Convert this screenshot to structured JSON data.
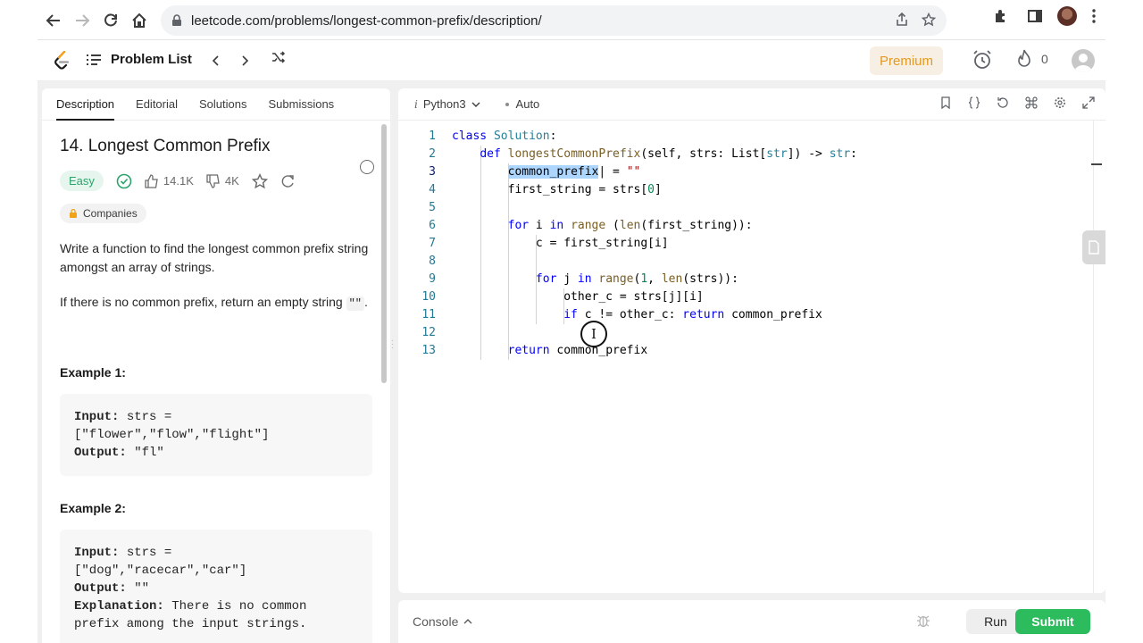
{
  "browser": {
    "url": "leetcode.com/problems/longest-common-prefix/description/"
  },
  "header": {
    "problem_list_label": "Problem List",
    "premium_label": "Premium",
    "streak_count": "0"
  },
  "left_tabs": [
    "Description",
    "Editorial",
    "Solutions",
    "Submissions"
  ],
  "problem": {
    "title": "14. Longest Common Prefix",
    "difficulty": "Easy",
    "likes": "14.1K",
    "dislikes": "4K",
    "companies_label": "Companies",
    "paragraph1": "Write a function to find the longest common prefix string amongst an array of strings.",
    "paragraph2_prefix": "If there is no common prefix, return an empty string",
    "paragraph2_code": "\"\"",
    "paragraph2_suffix": ".",
    "example1_title": "Example 1:",
    "example1_input_label": "Input:",
    "example1_input_a": "strs =",
    "example1_input_b": "[\"flower\",\"flow\",\"flight\"]",
    "example1_output_label": "Output:",
    "example1_output": "\"fl\"",
    "example2_title": "Example 2:",
    "example2_input_label": "Input:",
    "example2_input_a": "strs =",
    "example2_input_b": "[\"dog\",\"racecar\",\"car\"]",
    "example2_output_label": "Output:",
    "example2_output": "\"\"",
    "example2_explanation_label": "Explanation:",
    "example2_explanation_a": "There is no common",
    "example2_explanation_b": "prefix among the input strings."
  },
  "editor": {
    "language_prefix": "i",
    "language": "Python3",
    "mode": "Auto",
    "line_numbers": [
      "1",
      "2",
      "3",
      "4",
      "5",
      "6",
      "7",
      "8",
      "9",
      "10",
      "11",
      "12",
      "13"
    ]
  },
  "console": {
    "label": "Console",
    "run_label": "Run",
    "submit_label": "Submit"
  },
  "colors": {
    "accent_green": "#2cbb5d",
    "premium_orange": "#e39a1f",
    "easy_green": "#2aa46b"
  }
}
